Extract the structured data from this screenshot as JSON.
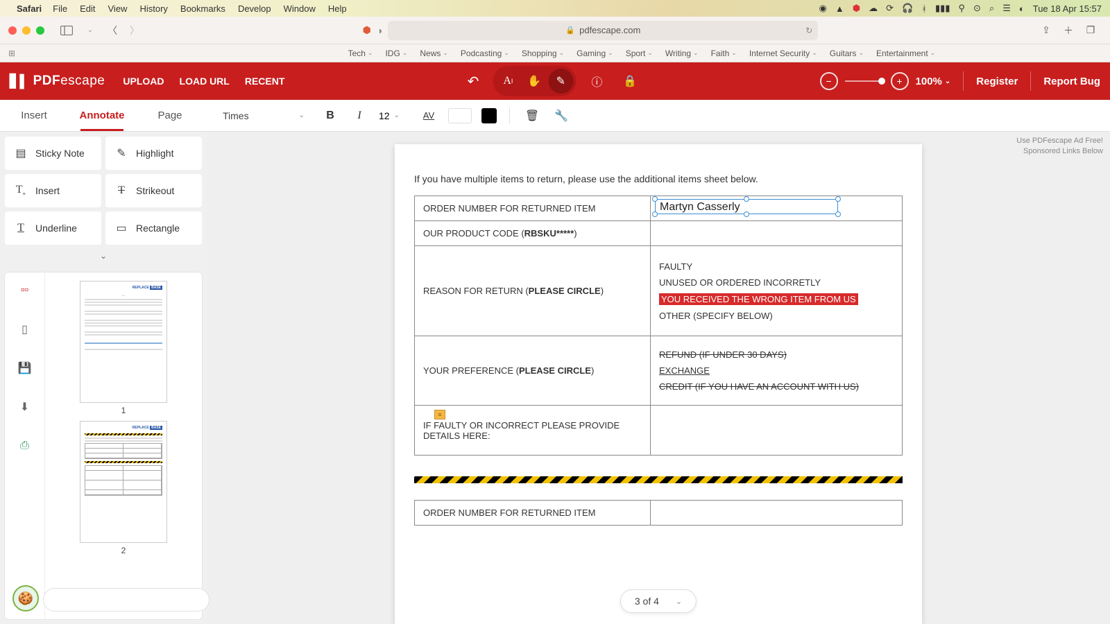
{
  "mac_menu": {
    "app": "Safari",
    "items": [
      "File",
      "Edit",
      "View",
      "History",
      "Bookmarks",
      "Develop",
      "Window",
      "Help"
    ],
    "clock": "Tue 18 Apr 15:57"
  },
  "safari": {
    "url_host": "pdfescape.com",
    "bookmarks": [
      "Tech",
      "IDG",
      "News",
      "Podcasting",
      "Shopping",
      "Gaming",
      "Sport",
      "Writing",
      "Faith",
      "Internet Security",
      "Guitars",
      "Entertainment"
    ]
  },
  "app": {
    "logo_main": "PDF",
    "logo_sub": "escape",
    "file_actions": {
      "upload": "UPLOAD",
      "load_url": "LOAD URL",
      "recent": "RECENT"
    },
    "zoom": "100%",
    "register": "Register",
    "report_bug": "Report Bug"
  },
  "tabs": {
    "insert": "Insert",
    "annotate": "Annotate",
    "page": "Page"
  },
  "fmt": {
    "font": "Times",
    "size": "12"
  },
  "tools": {
    "sticky": "Sticky Note",
    "highlight": "Highlight",
    "insert": "Insert",
    "strikeout": "Strikeout",
    "underline": "Underline",
    "rectangle": "Rectangle"
  },
  "thumbs": {
    "p1": "1",
    "p2": "2",
    "brand_a": "REPLACE",
    "brand_b": "BASE"
  },
  "doc": {
    "intro": "If you have multiple items to return, please use the additional items sheet below.",
    "rows": {
      "order_num": "ORDER NUMBER FOR RETURNED ITEM",
      "product_code_a": "OUR PRODUCT CODE (",
      "product_code_b": "RBSKU*****",
      "product_code_c": ")",
      "reason_a": "REASON FOR RETURN (",
      "reason_b": "PLEASE CIRCLE",
      "reason_c": ")",
      "pref_a": "YOUR PREFERENCE (",
      "pref_b": "PLEASE CIRCLE",
      "pref_c": ")",
      "details": "IF FAULTY OR INCORRECT PLEASE PROVIDE DETAILS HERE:"
    },
    "reason_opts": {
      "faulty": "FAULTY",
      "unused": "UNUSED OR ORDERED INCORRETLY",
      "wrong": "YOU RECEIVED THE WRONG ITEM FROM US",
      "other": "OTHER (SPECIFY BELOW)"
    },
    "pref_opts": {
      "refund": "REFUND (IF UNDER 30 DAYS) ",
      "exchange": "EXCHANGE ",
      "credit": "CREDIT (IF YOU HAVE AN ACCOUNT WITH US)"
    },
    "typed_name": "Martyn Casserly",
    "order_num2": "ORDER NUMBER FOR RETURNED ITEM"
  },
  "ad": {
    "line1": "Use PDFescape Ad Free!",
    "line2": "Sponsored Links Below"
  },
  "pager": "3 of 4"
}
